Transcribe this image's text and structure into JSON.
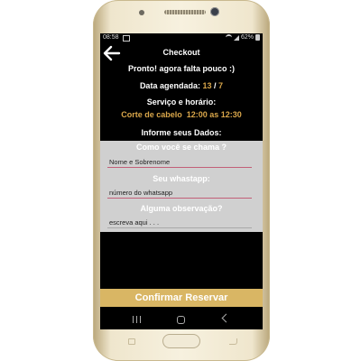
{
  "status_bar": {
    "time": "08:58",
    "battery": "62%"
  },
  "header": {
    "title": "Checkout"
  },
  "content": {
    "ready_text": "Pronto! agora falta pouco :)",
    "date_label": "Data agendada:",
    "date_day": "13",
    "date_sep": "/",
    "date_month": "7",
    "service_label": "Serviço e horário:",
    "service_value": "Corte de cabelo  12:00 as 12:30",
    "inform_label": "Informe seus Dados:"
  },
  "form": {
    "name_question": "Como você se chama ?",
    "name_placeholder": "Nome e Sobrenome",
    "whatsapp_question": "Seu whastapp:",
    "whatsapp_placeholder": "número do whatsapp",
    "notes_question": "Alguma observação?",
    "notes_placeholder": "escreva aqui . . ."
  },
  "actions": {
    "confirm_label": "Confirmar Reservar"
  },
  "colors": {
    "accent": "#d9a64a",
    "button": "#d9b664",
    "form_bg": "#d0d0d0"
  },
  "icons": {
    "back": "arrow-left-icon",
    "wifi": "wifi-icon",
    "signal": "signal-icon",
    "battery": "battery-icon",
    "nav_recents": "recents-icon",
    "nav_home": "home-icon",
    "nav_back": "back-icon"
  }
}
